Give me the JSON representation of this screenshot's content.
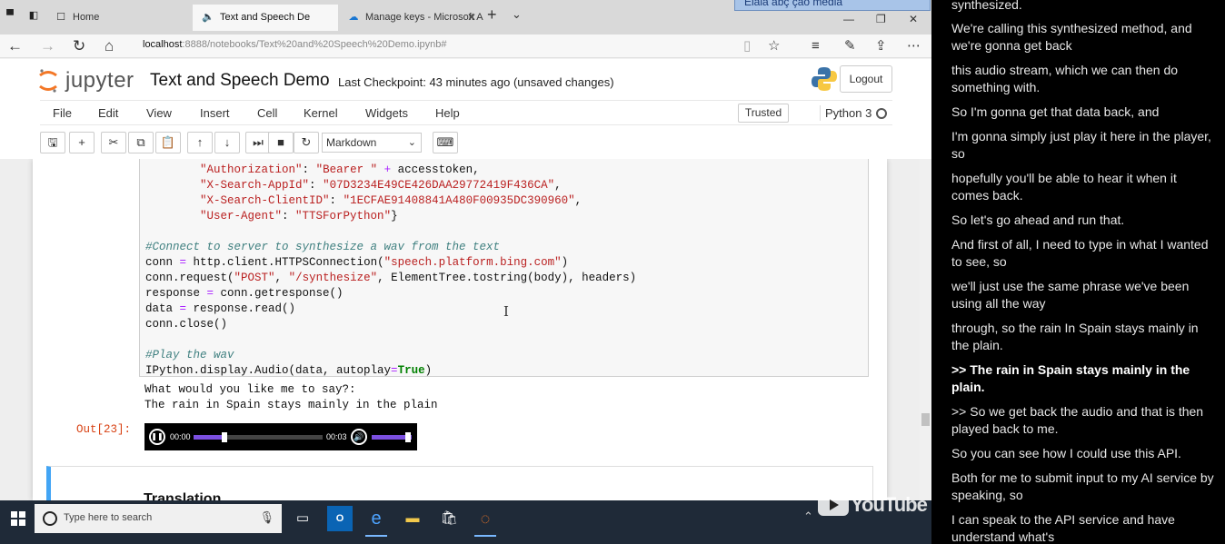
{
  "browser": {
    "tabs": [
      {
        "label": "Home",
        "icon": "page-icon"
      },
      {
        "label": "Text and Speech De",
        "icon": "speaker-icon",
        "active": true
      },
      {
        "label": "Manage keys - Microsoft Az",
        "icon": "azure-icon"
      }
    ],
    "ad_label": "Elala abç çao média",
    "url_host": "localhost",
    "url_rest": ":8888/notebooks/Text%20and%20Speech%20Demo.ipynb#"
  },
  "jupyter": {
    "logo_text": "jupyter",
    "notebook_title": "Text and Speech Demo",
    "checkpoint": "Last Checkpoint: 43 minutes ago (unsaved changes)",
    "logout": "Logout",
    "menu": [
      "File",
      "Edit",
      "View",
      "Insert",
      "Cell",
      "Kernel",
      "Widgets",
      "Help"
    ],
    "trusted": "Trusted",
    "kernel": "Python 3",
    "cell_type": "Markdown",
    "out_prompt": "Out[23]:",
    "output_lines": [
      "What would you like me to say?:",
      "The rain in Spain stays mainly in the plain"
    ],
    "audio": {
      "current": "00:00",
      "duration": "00:03",
      "progress": 0.24,
      "volume": 0.85
    },
    "md_heading": "Translation"
  },
  "taskbar": {
    "search_placeholder": "Type here to search"
  },
  "overlay": {
    "youtube": "YouTube"
  },
  "transcript": [
    {
      "text": "synthesized.",
      "current": false
    },
    {
      "text": "We're calling this synthesized method, and we're gonna get back",
      "current": false
    },
    {
      "text": "this audio stream, which we can then do something with.",
      "current": false
    },
    {
      "text": "So I'm gonna get that data back, and",
      "current": false
    },
    {
      "text": "I'm gonna simply just play it here in the player, so",
      "current": false
    },
    {
      "text": "hopefully you'll be able to hear it when it comes back.",
      "current": false
    },
    {
      "text": "So let's go ahead and run that.",
      "current": false
    },
    {
      "text": "And first of all, I need to type in what I wanted to see, so",
      "current": false
    },
    {
      "text": "we'll just use the same phrase we've been using all the way",
      "current": false
    },
    {
      "text": "through, so the rain In Spain stays mainly in the plain.",
      "current": false
    },
    {
      "text": ">> The rain in Spain stays mainly in the plain.",
      "current": true
    },
    {
      "text": ">> So we get back the audio and that is then played back to me.",
      "current": false
    },
    {
      "text": "So you can see how I could use this API.",
      "current": false
    },
    {
      "text": "Both for me to submit input to my AI service by speaking, so",
      "current": false
    },
    {
      "text": "I can speak to the API service and have understand what's",
      "current": false
    }
  ]
}
